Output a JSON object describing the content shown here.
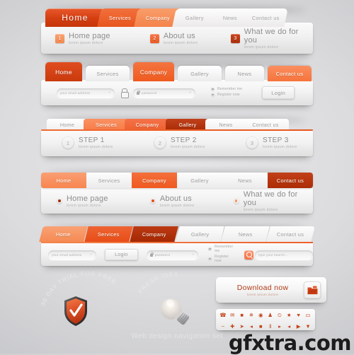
{
  "brand": {
    "accent_orange": "#ef5a1f",
    "accent_dark_red": "#a82c06",
    "accent_light": "#f9a373",
    "panel_bg": "#f2f2f2"
  },
  "panel1": {
    "tabs": [
      {
        "label": "Home",
        "state": "active"
      },
      {
        "label": "Services",
        "state": "orange"
      },
      {
        "label": "Company",
        "state": "light-orange"
      },
      {
        "label": "Gallery",
        "state": "white"
      },
      {
        "label": "News",
        "state": "white"
      },
      {
        "label": "Contact us",
        "state": "white"
      }
    ],
    "items": [
      {
        "num": "1",
        "title": "Home page",
        "sub": "lorem ipsum dolore"
      },
      {
        "num": "2",
        "title": "About us",
        "sub": "lorem ipsum dolore"
      },
      {
        "num": "3",
        "title": "What we do for you",
        "sub": "lorem ipsum dolore"
      }
    ]
  },
  "panel2": {
    "tabs": [
      {
        "label": "Home",
        "state": "red"
      },
      {
        "label": "Services",
        "state": "white"
      },
      {
        "label": "Company",
        "state": "orange"
      },
      {
        "label": "Gallery",
        "state": "white"
      },
      {
        "label": "News",
        "state": "white"
      },
      {
        "label": "Contact us",
        "state": "salmon"
      }
    ],
    "email_placeholder": "your email address",
    "password_placeholder": "password",
    "remember_label": "Remember me",
    "register_label": "Register now",
    "login_label": "Login",
    "lock_icon": "padlock-icon",
    "check_glyph": "✓"
  },
  "panel3": {
    "tabs": [
      {
        "label": "Home",
        "state": "white"
      },
      {
        "label": "Services",
        "state": "light-orange"
      },
      {
        "label": "Company",
        "state": "orange"
      },
      {
        "label": "Gallery",
        "state": "dark-red"
      },
      {
        "label": "News",
        "state": "white"
      },
      {
        "label": "Contact us",
        "state": "white"
      }
    ],
    "steps": [
      {
        "num": "1",
        "title": "STEP 1",
        "sub": "lorem ipsum dolore"
      },
      {
        "num": "2",
        "title": "STEP 2",
        "sub": "lorem ipsum dolore"
      },
      {
        "num": "3",
        "title": "STEP 3",
        "sub": "lorem ipsum dolore"
      }
    ]
  },
  "panel4": {
    "tabs": [
      {
        "label": "Home",
        "state": "light-orange"
      },
      {
        "label": "Services",
        "state": "white"
      },
      {
        "label": "Company",
        "state": "orange"
      },
      {
        "label": "Gallery",
        "state": "white"
      },
      {
        "label": "News",
        "state": "white"
      },
      {
        "label": "Contact us",
        "state": "dark-red"
      }
    ],
    "items": [
      {
        "title": "Home page",
        "sub": "lorem ipsum dolore"
      },
      {
        "title": "About us",
        "sub": "lorem ipsum dolore"
      },
      {
        "title": "What we do for you",
        "sub": "lorem ipsum dolore"
      }
    ]
  },
  "panel5": {
    "tabs": [
      {
        "label": "Home",
        "state": "light-orange"
      },
      {
        "label": "Services",
        "state": "orange"
      },
      {
        "label": "Company",
        "state": "dark-red"
      },
      {
        "label": "Gallery",
        "state": "white"
      },
      {
        "label": "News",
        "state": "white"
      },
      {
        "label": "Contact us",
        "state": "white"
      }
    ],
    "email_placeholder": "your email address",
    "password_placeholder": "password",
    "login_label": "Login",
    "remember_label": "Remember me",
    "register_label": "Register now",
    "search_placeholder": "type your search...",
    "search_icon": "magnifier-icon"
  },
  "badges": {
    "trial_text": "30 DAY TRIAL FOR FREE",
    "trial_icon": "shield-check-icon",
    "idea_text": "FRESH IDEA",
    "idea_icon": "lightbulb-icon"
  },
  "download": {
    "title": "Download now",
    "sub": "lorem ipsum dolore",
    "icon": "download-folder-icon"
  },
  "icon_strip": {
    "row1": [
      {
        "name": "phone-icon",
        "glyph": "☎"
      },
      {
        "name": "mail-icon",
        "glyph": "✉"
      },
      {
        "name": "briefcase-icon",
        "glyph": "ὋC"
      },
      {
        "name": "gear-icon",
        "glyph": "⚙"
      },
      {
        "name": "target-icon",
        "glyph": "◉"
      },
      {
        "name": "user-icon",
        "glyph": "♟"
      },
      {
        "name": "rss-icon",
        "glyph": "ॐ"
      },
      {
        "name": "star-icon",
        "glyph": "★"
      },
      {
        "name": "heart-icon",
        "glyph": "♥"
      },
      {
        "name": "comment-icon",
        "glyph": "▭"
      }
    ],
    "row2": [
      {
        "name": "minus-icon",
        "glyph": "−"
      },
      {
        "name": "plus-icon",
        "glyph": "✚"
      },
      {
        "name": "rocket-icon",
        "glyph": "✈"
      },
      {
        "name": "volume-icon",
        "glyph": "◂"
      },
      {
        "name": "stop-icon",
        "glyph": "■"
      },
      {
        "name": "pause-icon",
        "glyph": "‖"
      },
      {
        "name": "forward-icon",
        "glyph": "▸"
      },
      {
        "name": "rewind-icon",
        "glyph": "◂"
      },
      {
        "name": "play-icon",
        "glyph": "▶"
      },
      {
        "name": "pin-icon",
        "glyph": "▼"
      }
    ]
  },
  "footer": {
    "caption": "Web design navigation set",
    "watermark": "gfxtra.com"
  }
}
